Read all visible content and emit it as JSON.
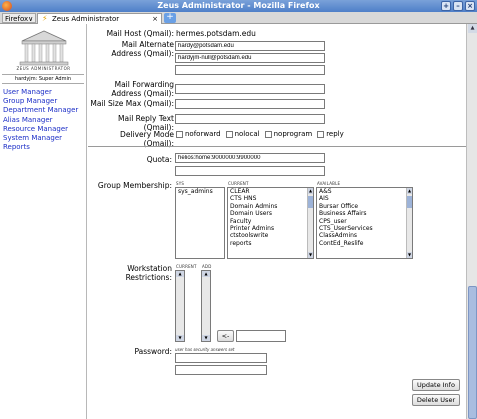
{
  "window": {
    "title": "Zeus Administrator - Mozilla Firefox",
    "controls": [
      "+",
      "–",
      "×"
    ]
  },
  "browser": {
    "menu_label": "Firefox∨",
    "tab_title": "Zeus Administrator",
    "tab_close": "×",
    "new_tab": "+"
  },
  "sidebar": {
    "logo_text": "ZEUS ADMINISTRATOR",
    "user_line": "hardyjm: Super Admin",
    "menu": [
      "User Manager",
      "Group Manager",
      "Department Manager",
      "Alias Manager",
      "Resource Manager",
      "System Manager",
      "Reports"
    ]
  },
  "form": {
    "mail_host_label": "Mail Host (Qmail):",
    "mail_host_value": "hermes.potsdam.edu",
    "alt_address_label": "Mail Alternate Address (Qmail):",
    "alt_addresses": [
      "hardy@potsdam.edu",
      "hardyjm-null@potsdam.edu",
      ""
    ],
    "forwarding_label": "Mail Forwarding Address (Qmail):",
    "forwarding_value": "",
    "size_max_label": "Mail Size Max (Qmail):",
    "size_max_value": "",
    "reply_text_label": "Mail Reply Text (Qmail):",
    "reply_text_value": "",
    "delivery_mode_label": "Delivery Mode (Qmail):",
    "delivery_options": [
      "noforward",
      "nolocal",
      "noprogram",
      "reply"
    ],
    "quota_label": "Quota:",
    "quota_values": [
      "helios:home:9000000:9900000",
      ""
    ],
    "group_membership_label": "Group Membership:",
    "group_col_sys": "SYS",
    "group_col_current": "CURRENT",
    "group_col_available": "AVAILABLE",
    "groups_sys": [
      "sys_admins"
    ],
    "groups_current": [
      "CLEAR",
      "CTS HNS",
      "Domain Admins",
      "Domain Users",
      "Faculty",
      "Printer Admins",
      "ctstoolswrite",
      "reports"
    ],
    "groups_available": [
      "A&S",
      "AIS",
      "Bursar Office",
      "Business Affairs",
      "CPS_user",
      "CTS_UserServices",
      "ClassAdmins",
      "ContEd_Reslife"
    ],
    "workstation_label": "Workstation Restrictions:",
    "ws_col_current": "CURRENT",
    "ws_col_add": "ADD",
    "ws_move_button": "<-",
    "ws_add_value": "",
    "password_label": "Password:",
    "password_hint": "user has security answers set",
    "password_values": [
      "",
      ""
    ],
    "update_button": "Update Info",
    "delete_button": "Delete User"
  }
}
